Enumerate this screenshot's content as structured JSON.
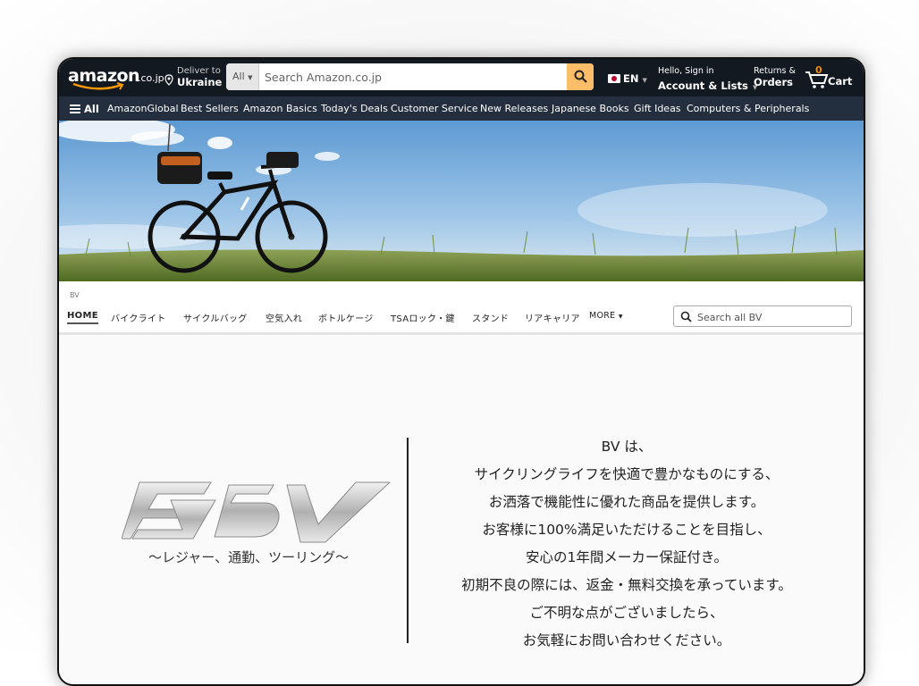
{
  "header": {
    "logo_word": "amazon",
    "logo_tld": ".co.jp",
    "deliver_line1": "Deliver to",
    "deliver_line2": "Ukraine",
    "search_category": "All",
    "search_placeholder": "Search Amazon.co.jp",
    "language": "EN",
    "account_line1": "Hello, Sign in",
    "account_line2": "Account & Lists",
    "orders_line1": "Returns &",
    "orders_line2": "Orders",
    "cart_count": "0",
    "cart_label": "Cart"
  },
  "nav": {
    "all_label": "All",
    "items": [
      "AmazonGlobal",
      "Best Sellers",
      "Amazon Basics",
      "Today's Deals",
      "Customer Service",
      "New Releases",
      "Japanese Books",
      "Gift Ideas",
      "Computers & Peripherals"
    ]
  },
  "store": {
    "breadcrumb": "BV",
    "tabs": [
      "HOME",
      "バイクライト",
      "サイクルバッグ",
      "空気入れ",
      "ボトルケージ",
      "TSAロック・鍵",
      "スタンド",
      "リアキャリア",
      "MORE"
    ],
    "search_placeholder": "Search all BV"
  },
  "content": {
    "tagline": "〜レジャー、通勤、ツーリング〜",
    "mission": [
      "BV は、",
      "サイクリングライフを快適で豊かなものにする、",
      "お洒落で機能性に優れた商品を提供します。",
      "お客様に100%満足いただけることを目指し、",
      "安心の1年間メーカー保証付き。",
      "初期不良の際には、返金・無料交換を承っています。",
      "ご不明な点がございましたら、",
      "お気軽にお問い合わせください。"
    ]
  },
  "colors": {
    "nav_top": "#131921",
    "nav_bottom": "#232f3e",
    "search_button": "#febd69",
    "cart_count": "#f08804",
    "sky": "#7fb3e0",
    "grass": "#6f8a3a"
  }
}
